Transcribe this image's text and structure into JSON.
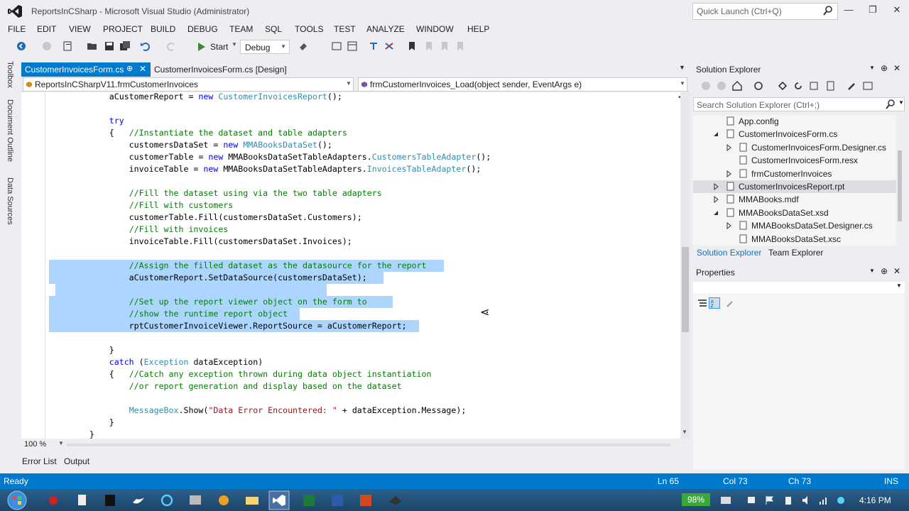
{
  "window": {
    "title": "ReportsInCSharp - Microsoft Visual Studio (Administrator)",
    "quick_launch_placeholder": "Quick Launch (Ctrl+Q)"
  },
  "menu": [
    "FILE",
    "EDIT",
    "VIEW",
    "PROJECT",
    "BUILD",
    "DEBUG",
    "TEAM",
    "SQL",
    "TOOLS",
    "TEST",
    "ANALYZE",
    "WINDOW",
    "HELP"
  ],
  "toolbar": {
    "start_label": "Start",
    "config_value": "Debug"
  },
  "side_tabs": [
    "Toolbox",
    "Document Outline",
    "Data Sources"
  ],
  "doc_tabs": [
    {
      "label": "CustomerInvoicesForm.cs",
      "active": true
    },
    {
      "label": "CustomerInvoicesForm.cs [Design]",
      "active": false
    }
  ],
  "navbar": {
    "class_combo": "ReportsInCSharpV11.frmCustomerInvoices",
    "member_combo": "frmCustomerInvoices_Load(object sender, EventArgs e)"
  },
  "code": [
    "            aCustomerReport = new CustomerInvoicesReport();",
    "",
    "            try",
    "            {   //Instantiate the dataset and table adapters",
    "                customersDataSet = new MMABooksDataSet();",
    "                customerTable = new MMABooksDataSetTableAdapters.CustomersTableAdapter();",
    "                invoiceTable = new MMABooksDataSetTableAdapters.InvoicesTableAdapter();",
    "",
    "                //Fill the dataset using via the two table adapters",
    "                //Fill with customers",
    "                customerTable.Fill(customersDataSet.Customers);",
    "                //Fill with invoices",
    "                invoiceTable.Fill(customersDataSet.Invoices);",
    "",
    "                //Assign the filled dataset as the datasource for the report",
    "                aCustomerReport.SetDataSource(customersDataSet);",
    "",
    "                //Set up the report viewer object on the form to",
    "                //show the runtime report object",
    "                rptCustomerInvoiceViewer.ReportSource = aCustomerReport;",
    "",
    "            }",
    "            catch (Exception dataException)",
    "            {   //Catch any exception thrown during data object instantiation",
    "                //or report generation and display based on the dataset",
    "",
    "                MessageBox.Show(\"Data Error Encountered: \" + dataException.Message);",
    "            }",
    "        }"
  ],
  "zoom": "100 %",
  "bottom_tabs": [
    "Error List",
    "Output"
  ],
  "status": {
    "text": "Ready",
    "ln": "Ln 65",
    "col": "Col 73",
    "ch": "Ch 73",
    "mode": "INS"
  },
  "solution_explorer": {
    "title": "Solution Explorer",
    "search_placeholder": "Search Solution Explorer (Ctrl+;)",
    "items": [
      {
        "label": "App.config",
        "depth": 1,
        "arrow": "none",
        "selected": false
      },
      {
        "label": "CustomerInvoicesForm.cs",
        "depth": 1,
        "arrow": "expanded",
        "selected": false
      },
      {
        "label": "CustomerInvoicesForm.Designer.cs",
        "depth": 2,
        "arrow": "collapsed",
        "selected": false
      },
      {
        "label": "CustomerInvoicesForm.resx",
        "depth": 2,
        "arrow": "none",
        "selected": false
      },
      {
        "label": "frmCustomerInvoices",
        "depth": 2,
        "arrow": "collapsed",
        "selected": false
      },
      {
        "label": "CustomerInvoicesReport.rpt",
        "depth": 1,
        "arrow": "collapsed",
        "selected": true
      },
      {
        "label": "MMABooks.mdf",
        "depth": 1,
        "arrow": "collapsed",
        "selected": false
      },
      {
        "label": "MMABooksDataSet.xsd",
        "depth": 1,
        "arrow": "expanded",
        "selected": false
      },
      {
        "label": "MMABooksDataSet.Designer.cs",
        "depth": 2,
        "arrow": "collapsed",
        "selected": false
      },
      {
        "label": "MMABooksDataSet.xsc",
        "depth": 2,
        "arrow": "none",
        "selected": false
      }
    ],
    "tabs": [
      "Solution Explorer",
      "Team Explorer"
    ]
  },
  "properties": {
    "title": "Properties"
  },
  "taskbar": {
    "battery": "98%",
    "clock": "4:16 PM"
  },
  "colors": {
    "accent": "#007acc",
    "selection": "#add6ff",
    "keyword": "#0000ff",
    "type": "#2b91af",
    "comment": "#008000",
    "string": "#a31515"
  }
}
